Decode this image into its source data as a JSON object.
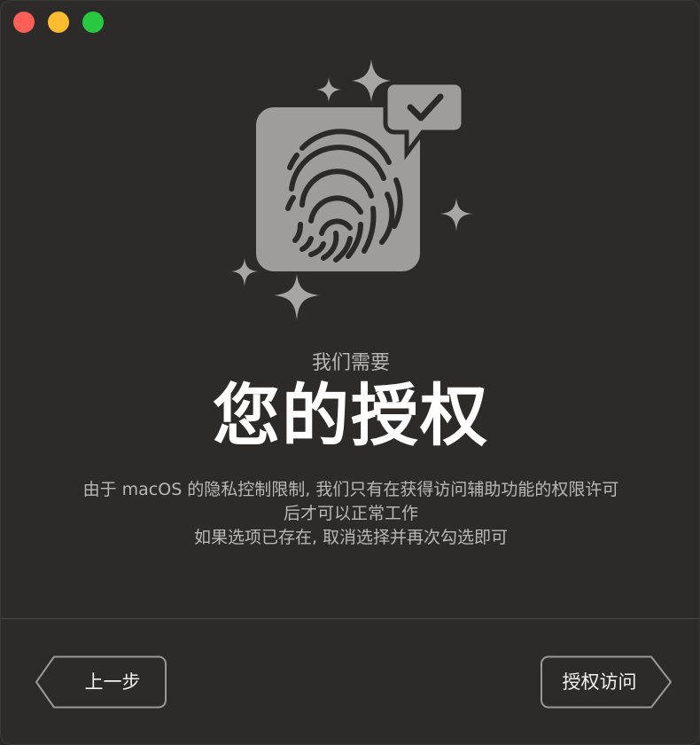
{
  "window": {
    "controls": [
      "close",
      "minimize",
      "zoom"
    ]
  },
  "hero": {
    "icons": [
      "fingerprint-icon",
      "checkmark-badge-icon",
      "sparkle-icon"
    ],
    "colors": {
      "tile": "#9e9d9b",
      "glyph": "#2b2a29",
      "sparkle": "#a7a6a4"
    }
  },
  "heading": {
    "subtitle": "我们需要",
    "title": "您的授权"
  },
  "description": {
    "line1": "由于 macOS 的隐私控制限制, 我们只有在获得访问辅助功能的权限许可",
    "line2": "后才可以正常工作",
    "line3": "如果选项已存在, 取消选择并再次勾选即可"
  },
  "footer": {
    "back_label": "上一步",
    "next_label": "授权访问"
  }
}
